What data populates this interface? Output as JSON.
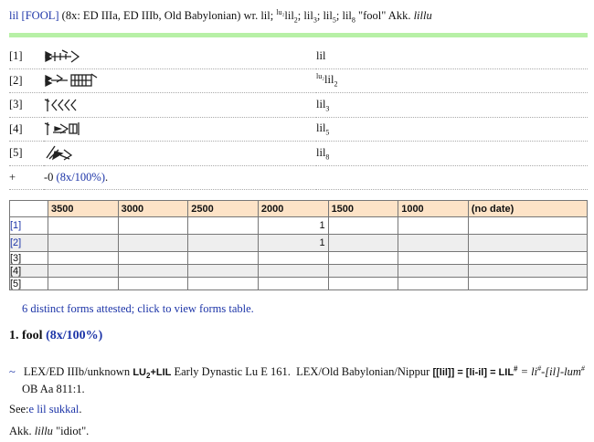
{
  "header": {
    "lemma": "lil",
    "pos": "FOOL",
    "attest": "(8x: ED IIIa, ED IIIb, Old Babylonian) wr.",
    "wr_1": "lil;",
    "wr_2_sup": "lu₂",
    "wr_2": "lil",
    "wr_2_sub": "2",
    "wr_3": "lil",
    "wr_3_sub": "3",
    "wr_5": "lil",
    "wr_5_sub": "5",
    "wr_8": "lil",
    "wr_8_sub": "8",
    "gloss": "\"fool\" Akk.",
    "akk": "lillu"
  },
  "forms": [
    {
      "idx": "[1]",
      "base": "lil",
      "sup": "",
      "sub": ""
    },
    {
      "idx": "[2]",
      "base": "lil",
      "sup": "lu₂",
      "sub": "2"
    },
    {
      "idx": "[3]",
      "base": "lil",
      "sup": "",
      "sub": "3"
    },
    {
      "idx": "[4]",
      "base": "lil",
      "sup": "",
      "sub": "5"
    },
    {
      "idx": "[5]",
      "base": "lil",
      "sup": "",
      "sub": "8"
    }
  ],
  "plus_row": {
    "mark": "+",
    "prefix": "-0",
    "count": "(8x/100%)",
    "suffix": "."
  },
  "dates": {
    "headers": [
      "3500",
      "3000",
      "2500",
      "2000",
      "1500",
      "1000",
      "(no date)"
    ],
    "rows": [
      {
        "label": "[1]",
        "cells": [
          "",
          "",
          "",
          "1",
          "",
          "",
          ""
        ]
      },
      {
        "label": "[2]",
        "cells": [
          "",
          "",
          "",
          "1",
          "",
          "",
          ""
        ]
      },
      {
        "label": "[3]",
        "cells": [
          "",
          "",
          "",
          "",
          "",
          "",
          ""
        ]
      },
      {
        "label": "[4]",
        "cells": [
          "",
          "",
          "",
          "",
          "",
          "",
          ""
        ]
      },
      {
        "label": "[5]",
        "cells": [
          "",
          "",
          "",
          "",
          "",
          "",
          ""
        ]
      }
    ]
  },
  "distinct_forms": "6 distinct forms attested; click to view forms table.",
  "sense": {
    "number": "1.",
    "word": "fool",
    "count": "(8x/100%)"
  },
  "lex": {
    "tilde": "~",
    "a": "LEX/ED IIIb/unknown",
    "b_lu": "LU",
    "b_sub": "2",
    "b_lil": "+LIL",
    "c": "Early Dynastic Lu E 161.",
    "d": "LEX/Old Babylonian/Nippur",
    "e": "[[lil]] = [li-il] = LIL",
    "e_sup": "#",
    "f": "= li",
    "f_sup": "#",
    "g": "-[il]-lum",
    "g_sup": "#",
    "h": "OB Aa 811:1."
  },
  "see": {
    "label": "See:",
    "link": "e lil sukkal",
    "end": "."
  },
  "akk": {
    "label": "Akk.",
    "word": "lillu",
    "gloss": "\"idiot\"."
  }
}
